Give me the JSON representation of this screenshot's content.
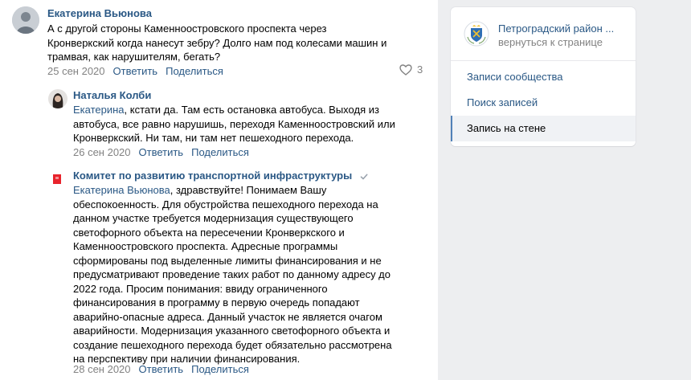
{
  "comments": [
    {
      "author": "Екатерина Вьюнова",
      "lines": [
        "А с другой стороны Каменноостровского проспекта через",
        "Кронверкский когда нанесут зебру? Долго нам под колесами машин и",
        "трамвая, как нарушителям, бегать?"
      ],
      "date": "25 сен 2020",
      "reply": "Ответить",
      "share": "Поделиться",
      "likes": "3"
    },
    {
      "author": "Наталья Колби",
      "reply_to": "Екатерина",
      "lines": [
        ", кстати да. Там есть остановка автобуса. Выходя из",
        "автобуса, все равно нарушишь, переходя Каменноостровский или",
        "Кронверкский. Ни там, ни там нет пешеходного перехода."
      ],
      "date": "26 сен 2020",
      "reply": "Ответить",
      "share": "Поделиться"
    },
    {
      "author": "Комитет по развитию транспортной инфраструктуры",
      "reply_to": "Екатерина Вьюнова",
      "lines": [
        ", здравствуйте! Понимаем Вашу",
        "обеспокоенность. Для обустройства пешеходного перехода на",
        "данном участке требуется модернизация существующего",
        "светофорного объекта на пересечении Кронверкского и",
        "Каменноостровского проспекта. Адресные программы",
        "сформированы под выделенные лимиты финансирования и не",
        "предусматривают проведение таких работ по данному адресу до",
        "2022 года. Просим понимания: ввиду ограниченного",
        "финансирования в программу в первую очередь попадают",
        "аварийно-опасные адреса. Данный участок не является очагом",
        "аварийности. Модернизация указанного светофорного объекта и",
        "создание пешеходного перехода будет обязательно рассмотрена",
        "на перспективу при наличии финансирования."
      ],
      "date": "28 сен 2020",
      "reply": "Ответить",
      "share": "Поделиться"
    }
  ],
  "sidebar": {
    "group_name": "Петроградский район ...",
    "back_link": "вернуться к странице",
    "menu": [
      {
        "label": "Записи сообщества",
        "active": false
      },
      {
        "label": "Поиск записей",
        "active": false
      },
      {
        "label": "Запись на стене",
        "active": true
      }
    ]
  },
  "colors": {
    "link": "#2a5885",
    "meta": "#828282",
    "accent": "#5181b8",
    "committee_logo": "#e8232c"
  }
}
